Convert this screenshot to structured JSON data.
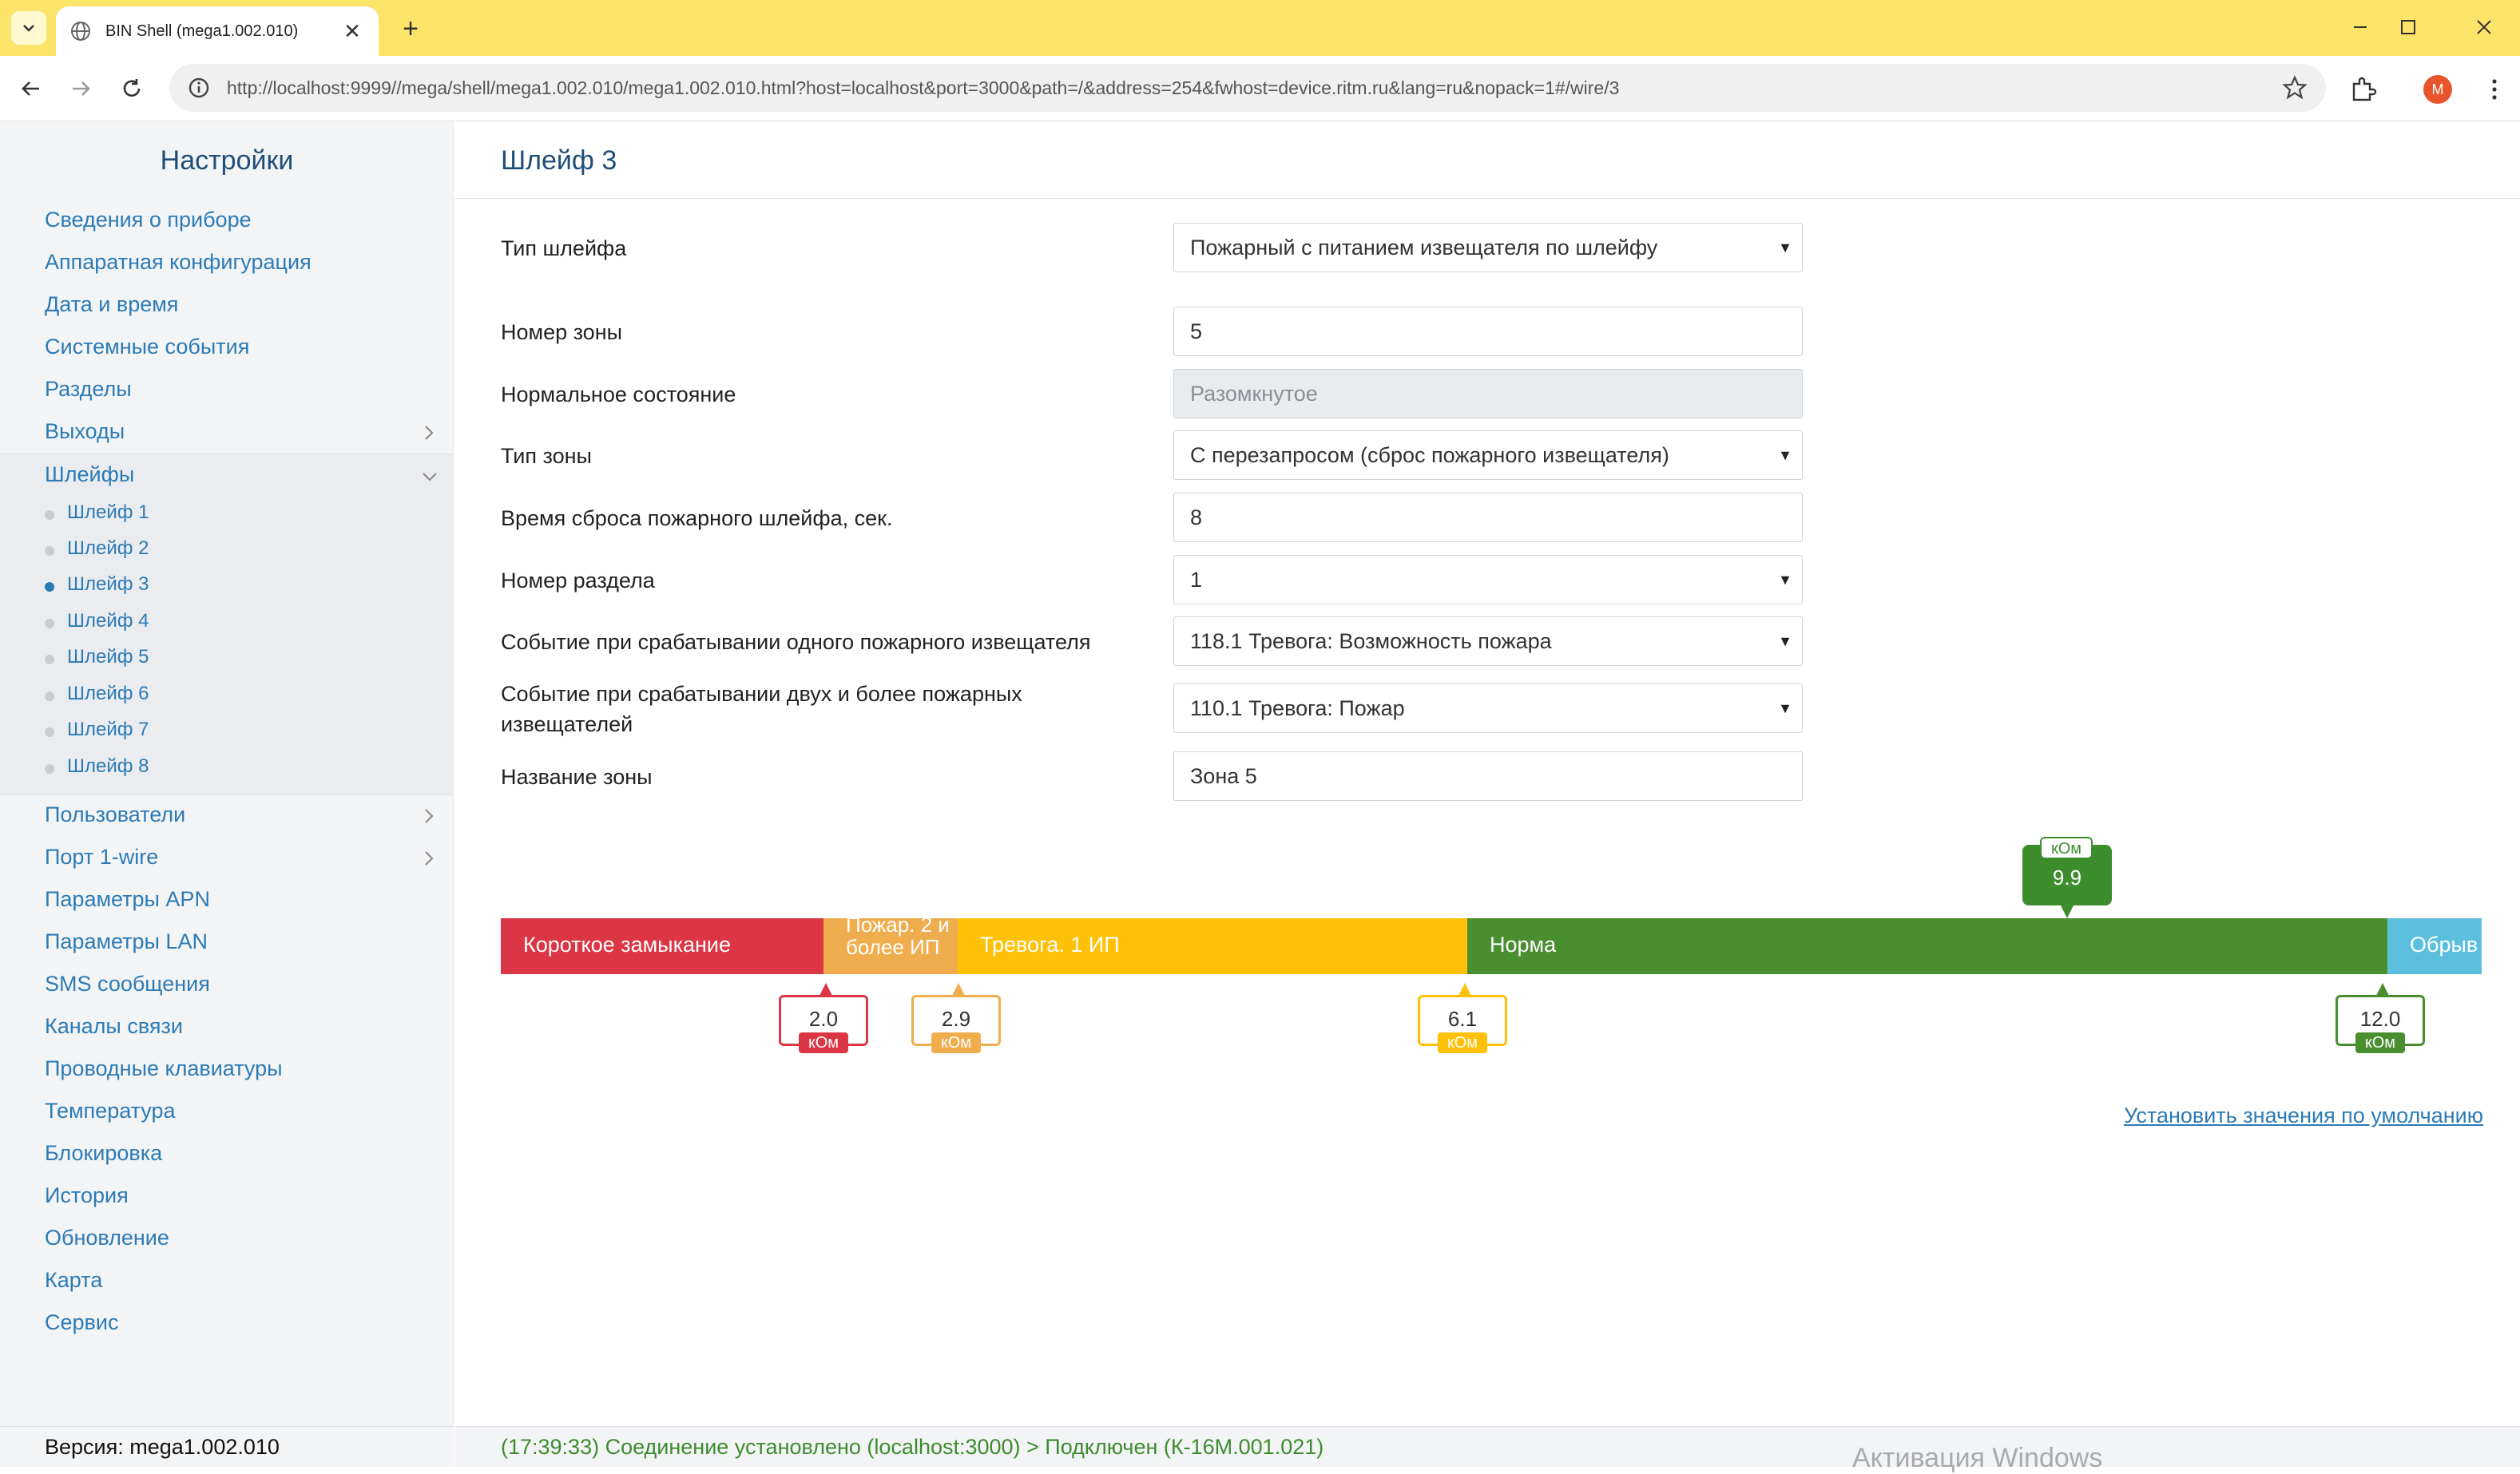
{
  "browser": {
    "tab_title": "BIN Shell (mega1.002.010)",
    "url": "http://localhost:9999//mega/shell/mega1.002.010/mega1.002.010.html?host=localhost&port=3000&path=/&address=254&fwhost=device.ritm.ru&lang=ru&nopack=1#/wire/3",
    "profile_initial": "M"
  },
  "sidebar": {
    "title": "Настройки",
    "items_top": [
      {
        "label": "Сведения о приборе"
      },
      {
        "label": "Аппаратная конфигурация"
      },
      {
        "label": "Дата и время"
      },
      {
        "label": "Системные события"
      },
      {
        "label": "Разделы"
      },
      {
        "label": "Выходы"
      }
    ],
    "group": {
      "label": "Шлейфы",
      "subitems": [
        "Шлейф 1",
        "Шлейф 2",
        "Шлейф 3",
        "Шлейф 4",
        "Шлейф 5",
        "Шлейф 6",
        "Шлейф 7",
        "Шлейф 8"
      ],
      "active_index": 2
    },
    "items_bottom": [
      {
        "label": "Пользователи"
      },
      {
        "label": "Порт 1-wire"
      },
      {
        "label": "Параметры APN"
      },
      {
        "label": "Параметры LAN"
      },
      {
        "label": "SMS сообщения"
      },
      {
        "label": "Каналы связи"
      },
      {
        "label": "Проводные клавиатуры"
      },
      {
        "label": "Температура"
      },
      {
        "label": "Блокировка"
      },
      {
        "label": "История"
      },
      {
        "label": "Обновление"
      },
      {
        "label": "Карта"
      },
      {
        "label": "Сервис"
      }
    ],
    "version": "Версия: mega1.002.010"
  },
  "main": {
    "title": "Шлейф 3",
    "fields": [
      {
        "label": "Тип шлейфа",
        "value": "Пожарный с питанием извещателя по шлейфу",
        "type": "select"
      },
      {
        "label": "Номер зоны",
        "value": "5",
        "type": "input"
      },
      {
        "label": "Нормальное состояние",
        "value": "Разомкнутое",
        "type": "disabled"
      },
      {
        "label": "Тип зоны",
        "value": "С перезапросом (сброс пожарного извещателя)",
        "type": "select"
      },
      {
        "label": "Время сброса пожарного шлейфа, сек.",
        "value": "8",
        "type": "input"
      },
      {
        "label": "Номер раздела",
        "value": "1",
        "type": "select"
      },
      {
        "label": "Событие при срабатывании одного пожарного извещателя",
        "value": "118.1 Тревога: Возможность пожара",
        "type": "select"
      },
      {
        "label": "Событие при срабатывании двух и более пожарных извещателей",
        "value": "110.1 Тревога: Пожар",
        "type": "select"
      },
      {
        "label": "Название зоны",
        "value": "Зона 5",
        "type": "input"
      }
    ],
    "scale": {
      "unit": "кОм",
      "segments": [
        {
          "label": "Короткое замыкание",
          "color": "#dc3545"
        },
        {
          "label": "Пожар. 2 и более ИП",
          "color": "#f0ad4e"
        },
        {
          "label": "Тревога. 1 ИП",
          "color": "#ffc107"
        },
        {
          "label": "Норма",
          "color": "#4a8f2f"
        },
        {
          "label": "Обрыв",
          "color": "#5bc0de"
        }
      ],
      "thresholds": [
        {
          "value": "2.0",
          "color": "#dc3545"
        },
        {
          "value": "2.9",
          "color": "#f0ad4e"
        },
        {
          "value": "6.1",
          "color": "#ffc107"
        },
        {
          "value": "12.0",
          "color": "#4a8f2f"
        }
      ],
      "current": {
        "value": "9.9",
        "color": "#3d8c2e"
      }
    },
    "default_link": "Установить значения по умолчанию"
  },
  "status": {
    "text": "(17:39:33) Соединение установлено (localhost:3000) > Подключен (К-16М.001.021)",
    "watermark": "Активация Windows"
  }
}
